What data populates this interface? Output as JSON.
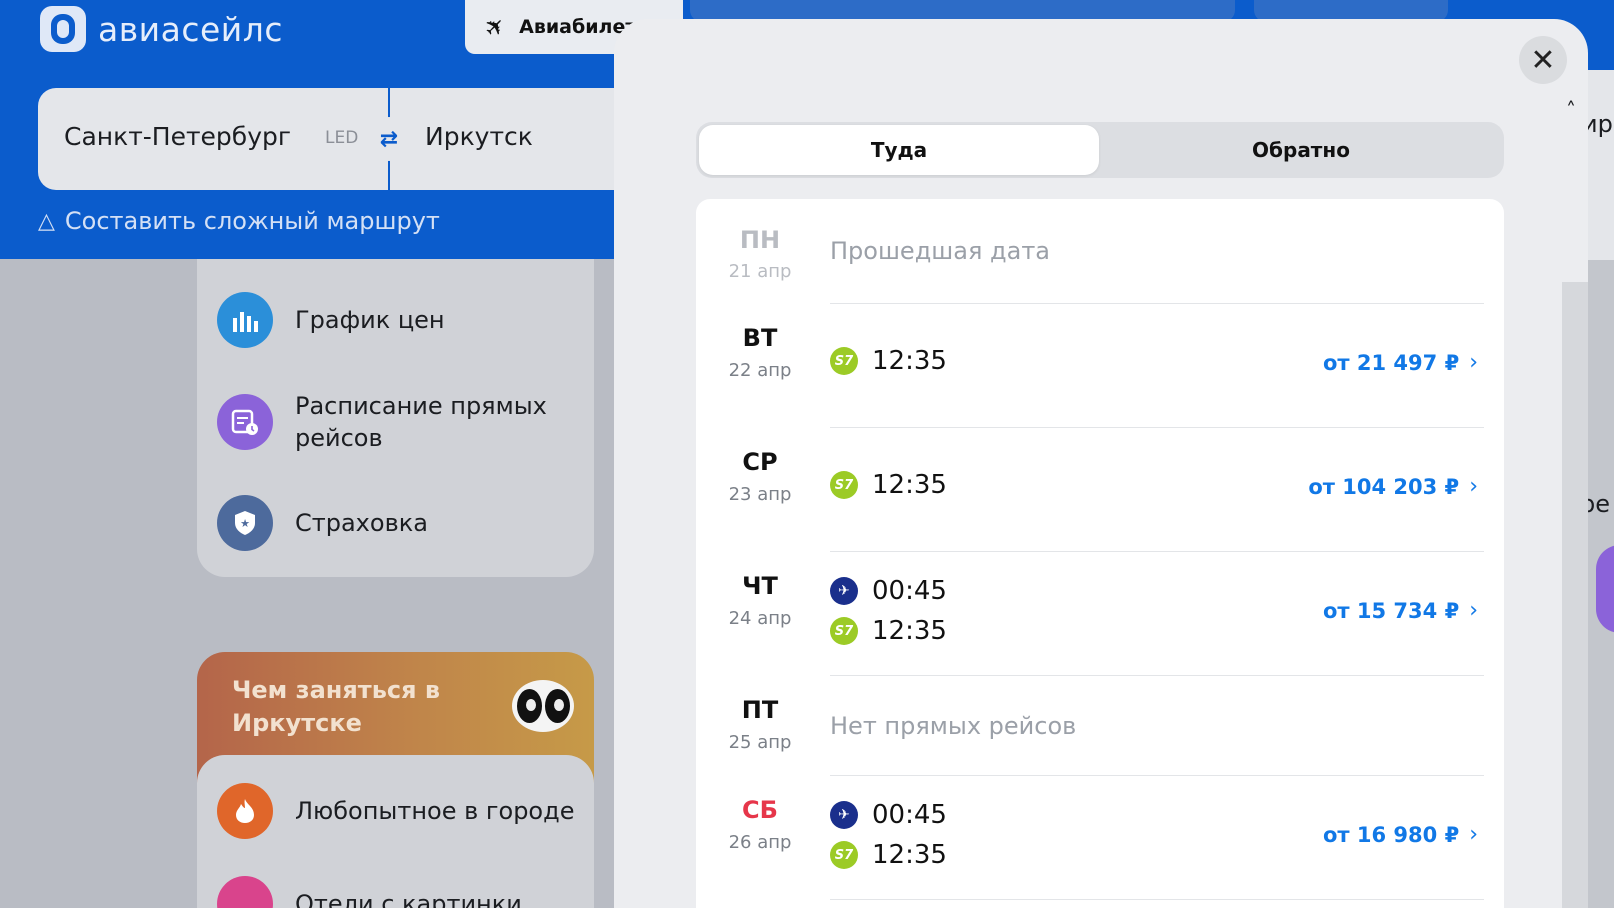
{
  "header": {
    "logo_text": "авиасейлс",
    "nav_active_label": "Авиабилеты"
  },
  "search": {
    "origin": "Санкт-Петербург",
    "origin_code": "LED",
    "destination": "Иркутск",
    "complex_route_label": "Составить сложный маршрут"
  },
  "services": [
    {
      "label": "График цен",
      "icon": "bar-chart-icon",
      "color": "#2b8fd9"
    },
    {
      "label": "Расписание прямых рейсов",
      "icon": "schedule-icon",
      "color": "#8b63d9"
    },
    {
      "label": "Страховка",
      "icon": "shield-icon",
      "color": "#4d6a9c"
    }
  ],
  "promo": {
    "title": "Чем заняться в Иркутске",
    "item_label": "Любопытное в городе",
    "item2_label": "Отели с картинки"
  },
  "side": {
    "text1": "ир",
    "text2": "ре"
  },
  "modal": {
    "tabs": [
      {
        "label": "Туда",
        "active": true
      },
      {
        "label": "Обратно",
        "active": false
      }
    ],
    "days": [
      {
        "dow": "ПН",
        "date": "21 апр",
        "status": "Прошедшая дата",
        "flights": [],
        "price": ""
      },
      {
        "dow": "ВТ",
        "date": "22 апр",
        "status": "",
        "flights": [
          {
            "airline": "s7",
            "time": "12:35"
          }
        ],
        "price": "от 21 497 ₽"
      },
      {
        "dow": "СР",
        "date": "23 апр",
        "status": "",
        "flights": [
          {
            "airline": "s7",
            "time": "12:35"
          }
        ],
        "price": "от 104 203 ₽"
      },
      {
        "dow": "ЧТ",
        "date": "24 апр",
        "status": "",
        "flights": [
          {
            "airline": "angara",
            "time": "00:45"
          },
          {
            "airline": "s7",
            "time": "12:35"
          }
        ],
        "price": "от 15 734 ₽"
      },
      {
        "dow": "ПТ",
        "date": "25 апр",
        "status": "Нет прямых рейсов",
        "flights": [],
        "price": ""
      },
      {
        "dow": "СБ",
        "date": "26 апр",
        "status": "",
        "flights": [
          {
            "airline": "angara",
            "time": "00:45"
          },
          {
            "airline": "s7",
            "time": "12:35"
          }
        ],
        "price": "от 16 980 ₽"
      }
    ]
  },
  "colors": {
    "brand_blue": "#0b5ccc",
    "price_blue": "#1178e6",
    "weekend_red": "#e6364a"
  }
}
